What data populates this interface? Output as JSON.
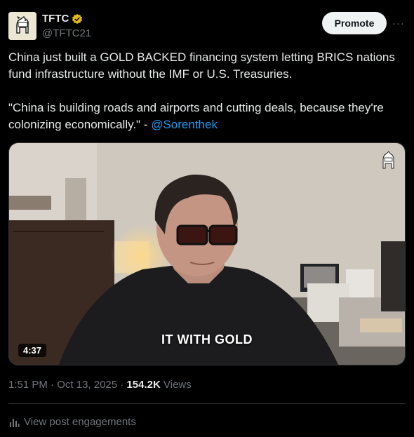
{
  "author": {
    "display_name": "TFTC",
    "handle": "@TFTC21",
    "verified_badge": "gold-verified-icon",
    "avatar": "horse-logo"
  },
  "actions": {
    "promote_label": "Promote",
    "more_label": "···"
  },
  "tweet": {
    "paragraph1": "China just built a GOLD BACKED financing system letting BRICS nations fund infrastructure without the IMF or U.S. Treasuries.",
    "paragraph2_text": "\"China is building roads and airports and cutting deals, because they're colonizing economically.\" - ",
    "mention": "@Sorenthek"
  },
  "media": {
    "duration": "4:37",
    "caption": "IT WITH GOLD"
  },
  "meta": {
    "time": "1:51 PM",
    "separator": " · ",
    "date": "Oct 13, 2025",
    "views_count": "154.2K",
    "views_label": " Views"
  },
  "engagements": {
    "label": "View post engagements",
    "icon": "bar-chart-icon"
  },
  "colors": {
    "background": "#000000",
    "text": "#e7e9ea",
    "muted": "#71767b",
    "link": "#1d9bf0",
    "promote_bg": "#eff3f4",
    "gold_badge": "#e2b719"
  }
}
